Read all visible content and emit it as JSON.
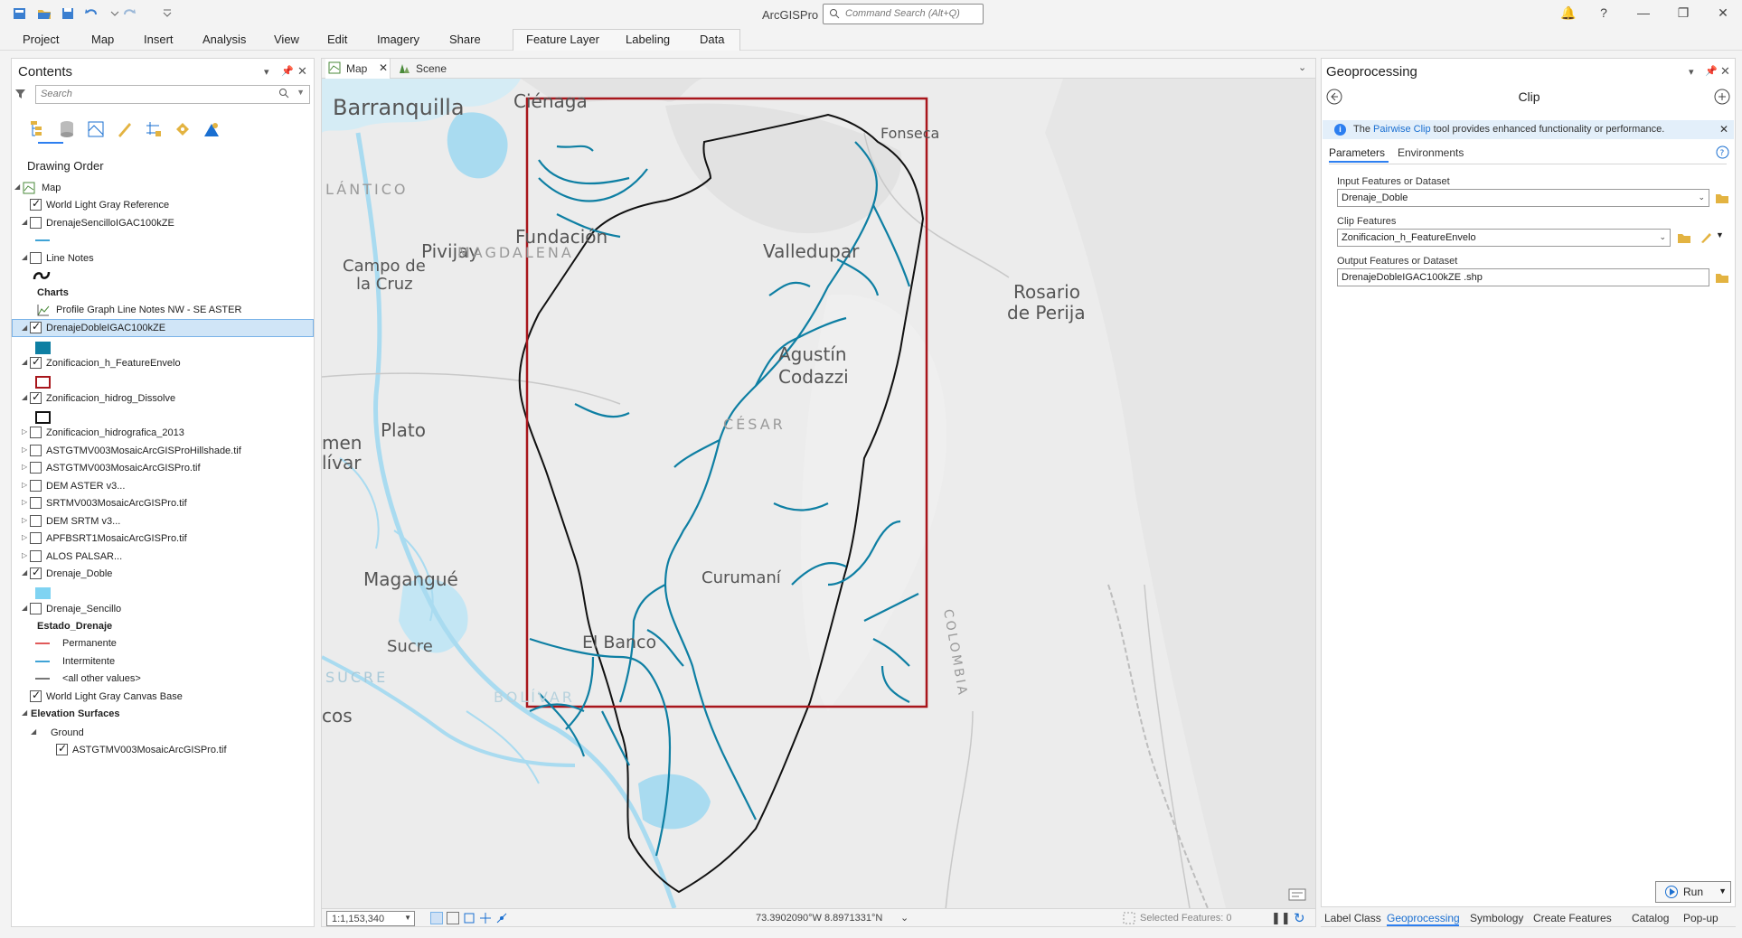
{
  "app": {
    "title": "ArcGISPro",
    "command_search_placeholder": "Command Search (Alt+Q)"
  },
  "ribbon": {
    "tabs": [
      "Project",
      "Map",
      "Insert",
      "Analysis",
      "View",
      "Edit",
      "Imagery",
      "Share",
      "Feature Layer",
      "Labeling",
      "Data"
    ]
  },
  "contents": {
    "title": "Contents",
    "search_placeholder": "Search",
    "drawing_order": "Drawing Order",
    "rows": [
      {
        "label": "Map"
      },
      {
        "label": "World Light Gray Reference"
      },
      {
        "label": "DrenajeSencilloIGAC100kZE"
      },
      {
        "label": "Line Notes"
      },
      {
        "label": "Charts"
      },
      {
        "label": "Profile Graph Line Notes NW - SE ASTER"
      },
      {
        "label": "DrenajeDobleIGAC100kZE"
      },
      {
        "label": "Zonificacion_h_FeatureEnvelo"
      },
      {
        "label": "Zonificacion_hidrog_Dissolve"
      },
      {
        "label": "Zonificacion_hidrografica_2013"
      },
      {
        "label": "ASTGTMV003MosaicArcGISProHillshade.tif"
      },
      {
        "label": "ASTGTMV003MosaicArcGISPro.tif"
      },
      {
        "label": "DEM ASTER v3..."
      },
      {
        "label": "SRTMV003MosaicArcGISPro.tif"
      },
      {
        "label": "DEM SRTM v3..."
      },
      {
        "label": "APFBSRT1MosaicArcGISPro.tif"
      },
      {
        "label": "ALOS PALSAR..."
      },
      {
        "label": "Drenaje_Doble"
      },
      {
        "label": "Drenaje_Sencillo"
      },
      {
        "label": "Estado_Drenaje"
      },
      {
        "label": "Permanente"
      },
      {
        "label": "Intermitente"
      },
      {
        "label": "<all other values>"
      },
      {
        "label": "World Light Gray Canvas Base"
      },
      {
        "label": "Elevation Surfaces"
      },
      {
        "label": "Ground"
      },
      {
        "label": "ASTGTMV003MosaicArcGISPro.tif"
      }
    ]
  },
  "map": {
    "tabs": [
      "Map",
      "Scene"
    ],
    "places": [
      "Barranquilla",
      "Ciénaga",
      "Fonseca",
      "LÁNTICO",
      "Pivijay",
      "MAGDALENA",
      "Fundación",
      "Valledupar",
      "Campo de",
      "la Cruz",
      "Rosario",
      "de Perija",
      "Agustín",
      "Codazzi",
      "CÉSAR",
      "Plato",
      "men",
      "lívar",
      "Magangué",
      "Curumaní",
      "El Banco",
      "Sucre",
      "SUCRE",
      "BOLÍVAR",
      "COLOMBIA",
      "cos"
    ],
    "scale": "1:1,153,340",
    "coords": "73.3902090°W 8.8971331°N",
    "selected_features": "Selected Features: 0"
  },
  "geoprocessing": {
    "title": "Geoprocessing",
    "tool": "Clip",
    "info_prefix": "The ",
    "info_link": "Pairwise Clip",
    "info_suffix": " tool provides enhanced functionality or performance.",
    "tabs": [
      "Parameters",
      "Environments"
    ],
    "input_label": "Input Features or Dataset",
    "input_value": "Drenaje_Doble",
    "clip_label": "Clip Features",
    "clip_value": "Zonificacion_h_FeatureEnvelo",
    "output_label": "Output Features or Dataset",
    "output_value": "DrenajeDobleIGAC100kZE .shp",
    "run_label": "Run"
  },
  "bottom_tabs": [
    "Label Class",
    "Geoprocessing",
    "Symbology",
    "Create Features",
    "Catalog",
    "Pop-up"
  ],
  "colors": {
    "accent": "#2d7ff0",
    "envelope": "#a8161c",
    "drainage": "#0e7fa3",
    "water": "#a9dbf0"
  }
}
